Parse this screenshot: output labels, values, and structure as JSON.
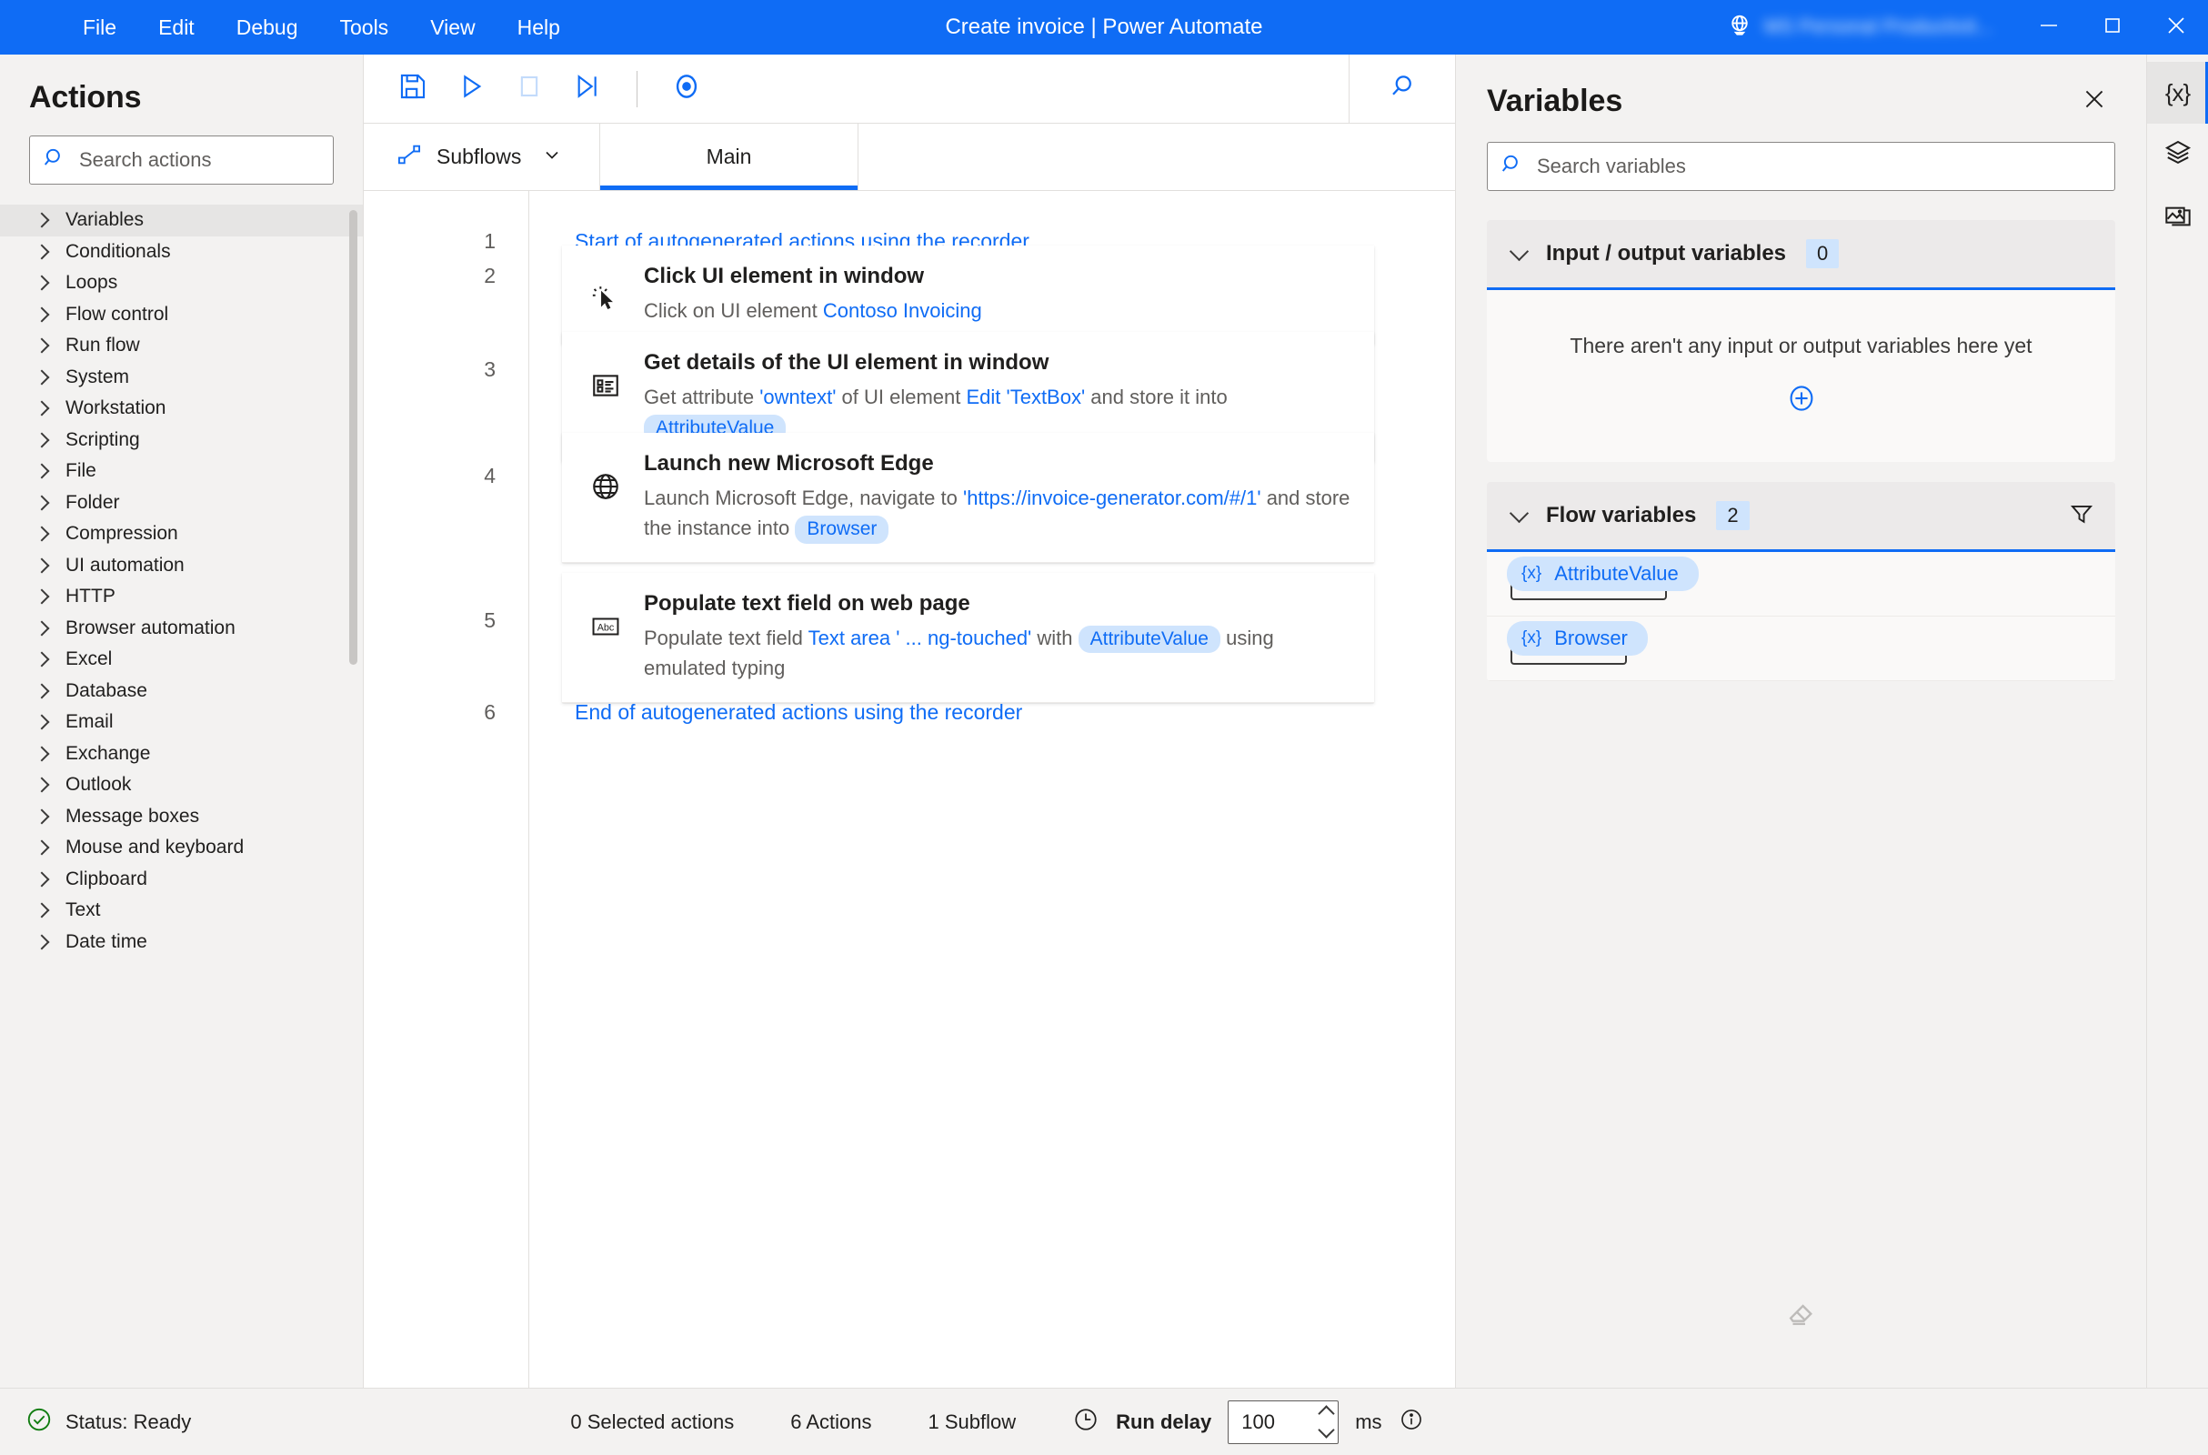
{
  "window": {
    "title": "Create invoice | Power Automate",
    "environment_name": "MS Personal Productivit...",
    "menu": [
      "File",
      "Edit",
      "Debug",
      "Tools",
      "View",
      "Help"
    ],
    "controls": {
      "minimize": "minimize-icon",
      "maximize": "maximize-icon",
      "close": "close-icon"
    },
    "accent_color": "#0f6cf5"
  },
  "actions_pane": {
    "title": "Actions",
    "search_placeholder": "Search actions",
    "search_value": "",
    "items": [
      {
        "label": "Variables",
        "selected": true
      },
      {
        "label": "Conditionals",
        "selected": false
      },
      {
        "label": "Loops",
        "selected": false
      },
      {
        "label": "Flow control",
        "selected": false
      },
      {
        "label": "Run flow",
        "selected": false
      },
      {
        "label": "System",
        "selected": false
      },
      {
        "label": "Workstation",
        "selected": false
      },
      {
        "label": "Scripting",
        "selected": false
      },
      {
        "label": "File",
        "selected": false
      },
      {
        "label": "Folder",
        "selected": false
      },
      {
        "label": "Compression",
        "selected": false
      },
      {
        "label": "UI automation",
        "selected": false
      },
      {
        "label": "HTTP",
        "selected": false
      },
      {
        "label": "Browser automation",
        "selected": false
      },
      {
        "label": "Excel",
        "selected": false
      },
      {
        "label": "Database",
        "selected": false
      },
      {
        "label": "Email",
        "selected": false
      },
      {
        "label": "Exchange",
        "selected": false
      },
      {
        "label": "Outlook",
        "selected": false
      },
      {
        "label": "Message boxes",
        "selected": false
      },
      {
        "label": "Mouse and keyboard",
        "selected": false
      },
      {
        "label": "Clipboard",
        "selected": false
      },
      {
        "label": "Text",
        "selected": false
      },
      {
        "label": "Date time",
        "selected": false
      }
    ]
  },
  "toolbar": {
    "save": "save-icon",
    "run": "run-icon",
    "stop": "stop-icon",
    "run_next": "run-next-action-icon",
    "record": "record-icon",
    "search": "search-icon"
  },
  "tabs": {
    "subflows_label": "Subflows",
    "main_label": "Main"
  },
  "flow": {
    "start_note": "Start of autogenerated actions using the recorder",
    "end_note": "End of autogenerated actions using the recorder",
    "start_line": "1",
    "end_line": "6",
    "steps": [
      {
        "line": "2",
        "icon": "click-cursor-icon",
        "title": "Click UI element in window",
        "desc_parts": [
          {
            "t": "Click on UI element ",
            "k": "plain"
          },
          {
            "t": "Contoso Invoicing",
            "k": "link"
          }
        ]
      },
      {
        "line": "3",
        "icon": "ui-element-details-icon",
        "title": "Get details of the UI element in window",
        "desc_parts": [
          {
            "t": "Get attribute ",
            "k": "plain"
          },
          {
            "t": "'owntext'",
            "k": "link"
          },
          {
            "t": " of UI element ",
            "k": "plain"
          },
          {
            "t": "Edit 'TextBox'",
            "k": "link"
          },
          {
            "t": " and store it into ",
            "k": "plain"
          },
          {
            "t": "AttributeValue",
            "k": "chip"
          }
        ]
      },
      {
        "line": "4",
        "icon": "globe-icon",
        "title": "Launch new Microsoft Edge",
        "desc_parts": [
          {
            "t": "Launch Microsoft Edge, navigate to ",
            "k": "plain"
          },
          {
            "t": "'https://invoice-generator.com/#/1'",
            "k": "link"
          },
          {
            "t": " and store the instance into ",
            "k": "plain"
          },
          {
            "t": "Browser",
            "k": "chip"
          }
        ]
      },
      {
        "line": "5",
        "icon": "abc-textfield-icon",
        "title": "Populate text field on web page",
        "desc_parts": [
          {
            "t": "Populate text field ",
            "k": "plain"
          },
          {
            "t": "Text area ' ...  ng-touched'",
            "k": "link"
          },
          {
            "t": " with ",
            "k": "plain"
          },
          {
            "t": "AttributeValue",
            "k": "chip"
          },
          {
            "t": " using emulated typing",
            "k": "plain"
          }
        ]
      }
    ]
  },
  "variables_pane": {
    "title": "Variables",
    "close": "close-icon",
    "search_placeholder": "Search variables",
    "search_value": "",
    "groups": [
      {
        "label": "Input / output variables",
        "count": "0",
        "empty_text": "There aren't any input or output variables here yet",
        "add_icon": "add-circle-icon",
        "has_filter": false,
        "variables": []
      },
      {
        "label": "Flow variables",
        "count": "2",
        "has_filter": true,
        "filter_icon": "filter-icon",
        "variables": [
          "AttributeValue",
          "Browser"
        ]
      }
    ],
    "eraser_icon": "eraser-icon",
    "var_glyph": "{x}"
  },
  "rail": [
    {
      "icon": "variables-braces-icon",
      "label": "{x}",
      "active": true
    },
    {
      "icon": "layers-ui-elements-icon",
      "label": "",
      "active": false
    },
    {
      "icon": "images-icon",
      "label": "",
      "active": false
    }
  ],
  "statusbar": {
    "status_icon": "status-ready-icon",
    "status_text": "Status: Ready",
    "selected_actions": "0 Selected actions",
    "actions_count": "6 Actions",
    "subflow_count": "1 Subflow",
    "clock_icon": "clock-icon",
    "run_delay_label": "Run delay",
    "run_delay_value": "100",
    "unit": "ms",
    "info_icon": "info-icon"
  }
}
